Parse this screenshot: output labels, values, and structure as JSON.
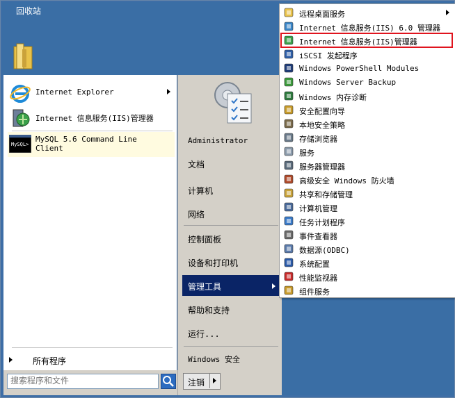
{
  "desktop": {
    "recycle_bin_label": "回收站"
  },
  "start_menu": {
    "pinned": [
      {
        "label": "Internet Explorer",
        "icon": "ie-icon",
        "has_arrow": true
      },
      {
        "label": "Internet 信息服务(IIS)管理器",
        "icon": "iis-icon",
        "has_arrow": false
      }
    ],
    "recent": [
      {
        "label_line1": "MySQL 5.6 Command Line",
        "label_line2": "Client",
        "icon": "mysql-terminal-icon"
      }
    ],
    "all_programs_label": "所有程序",
    "search_placeholder": "搜索程序和文件",
    "right_items": [
      {
        "label": "Administrator"
      },
      {
        "label": "文档"
      },
      {
        "label": "计算机"
      },
      {
        "label": "网络"
      },
      {
        "label": "控制面板"
      },
      {
        "label": "设备和打印机"
      },
      {
        "label": "管理工具",
        "active": true
      },
      {
        "label": "帮助和支持"
      },
      {
        "label": "运行..."
      },
      {
        "label": "Windows 安全"
      }
    ],
    "logout_label": "注销"
  },
  "submenu": {
    "items": [
      {
        "label": "远程桌面服务",
        "icon": "folder-icon",
        "has_arrow": true
      },
      {
        "label": "Internet 信息服务(IIS) 6.0 管理器",
        "icon": "iis6-icon"
      },
      {
        "label": "Internet 信息服务(IIS)管理器",
        "icon": "iis-icon",
        "highlighted": true
      },
      {
        "label": "iSCSI 发起程序",
        "icon": "iscsi-icon"
      },
      {
        "label": "Windows PowerShell Modules",
        "icon": "powershell-icon"
      },
      {
        "label": "Windows Server Backup",
        "icon": "backup-icon"
      },
      {
        "label": "Windows 内存诊断",
        "icon": "memory-icon"
      },
      {
        "label": "安全配置向导",
        "icon": "security-wizard-icon"
      },
      {
        "label": "本地安全策略",
        "icon": "local-policy-icon"
      },
      {
        "label": "存储浏览器",
        "icon": "storage-icon"
      },
      {
        "label": "服务",
        "icon": "services-icon"
      },
      {
        "label": "服务器管理器",
        "icon": "server-manager-icon"
      },
      {
        "label": "高级安全 Windows 防火墙",
        "icon": "firewall-icon"
      },
      {
        "label": "共享和存储管理",
        "icon": "share-icon"
      },
      {
        "label": "计算机管理",
        "icon": "computer-mgmt-icon"
      },
      {
        "label": "任务计划程序",
        "icon": "task-scheduler-icon"
      },
      {
        "label": "事件查看器",
        "icon": "event-viewer-icon"
      },
      {
        "label": "数据源(ODBC)",
        "icon": "odbc-icon"
      },
      {
        "label": "系统配置",
        "icon": "sysconfig-icon"
      },
      {
        "label": "性能监视器",
        "icon": "perfmon-icon"
      },
      {
        "label": "组件服务",
        "icon": "component-icon"
      }
    ]
  },
  "colors": {
    "desktop": "#3a6ea5",
    "active_item": "#0a2466",
    "highlight_border": "#e0141e"
  }
}
